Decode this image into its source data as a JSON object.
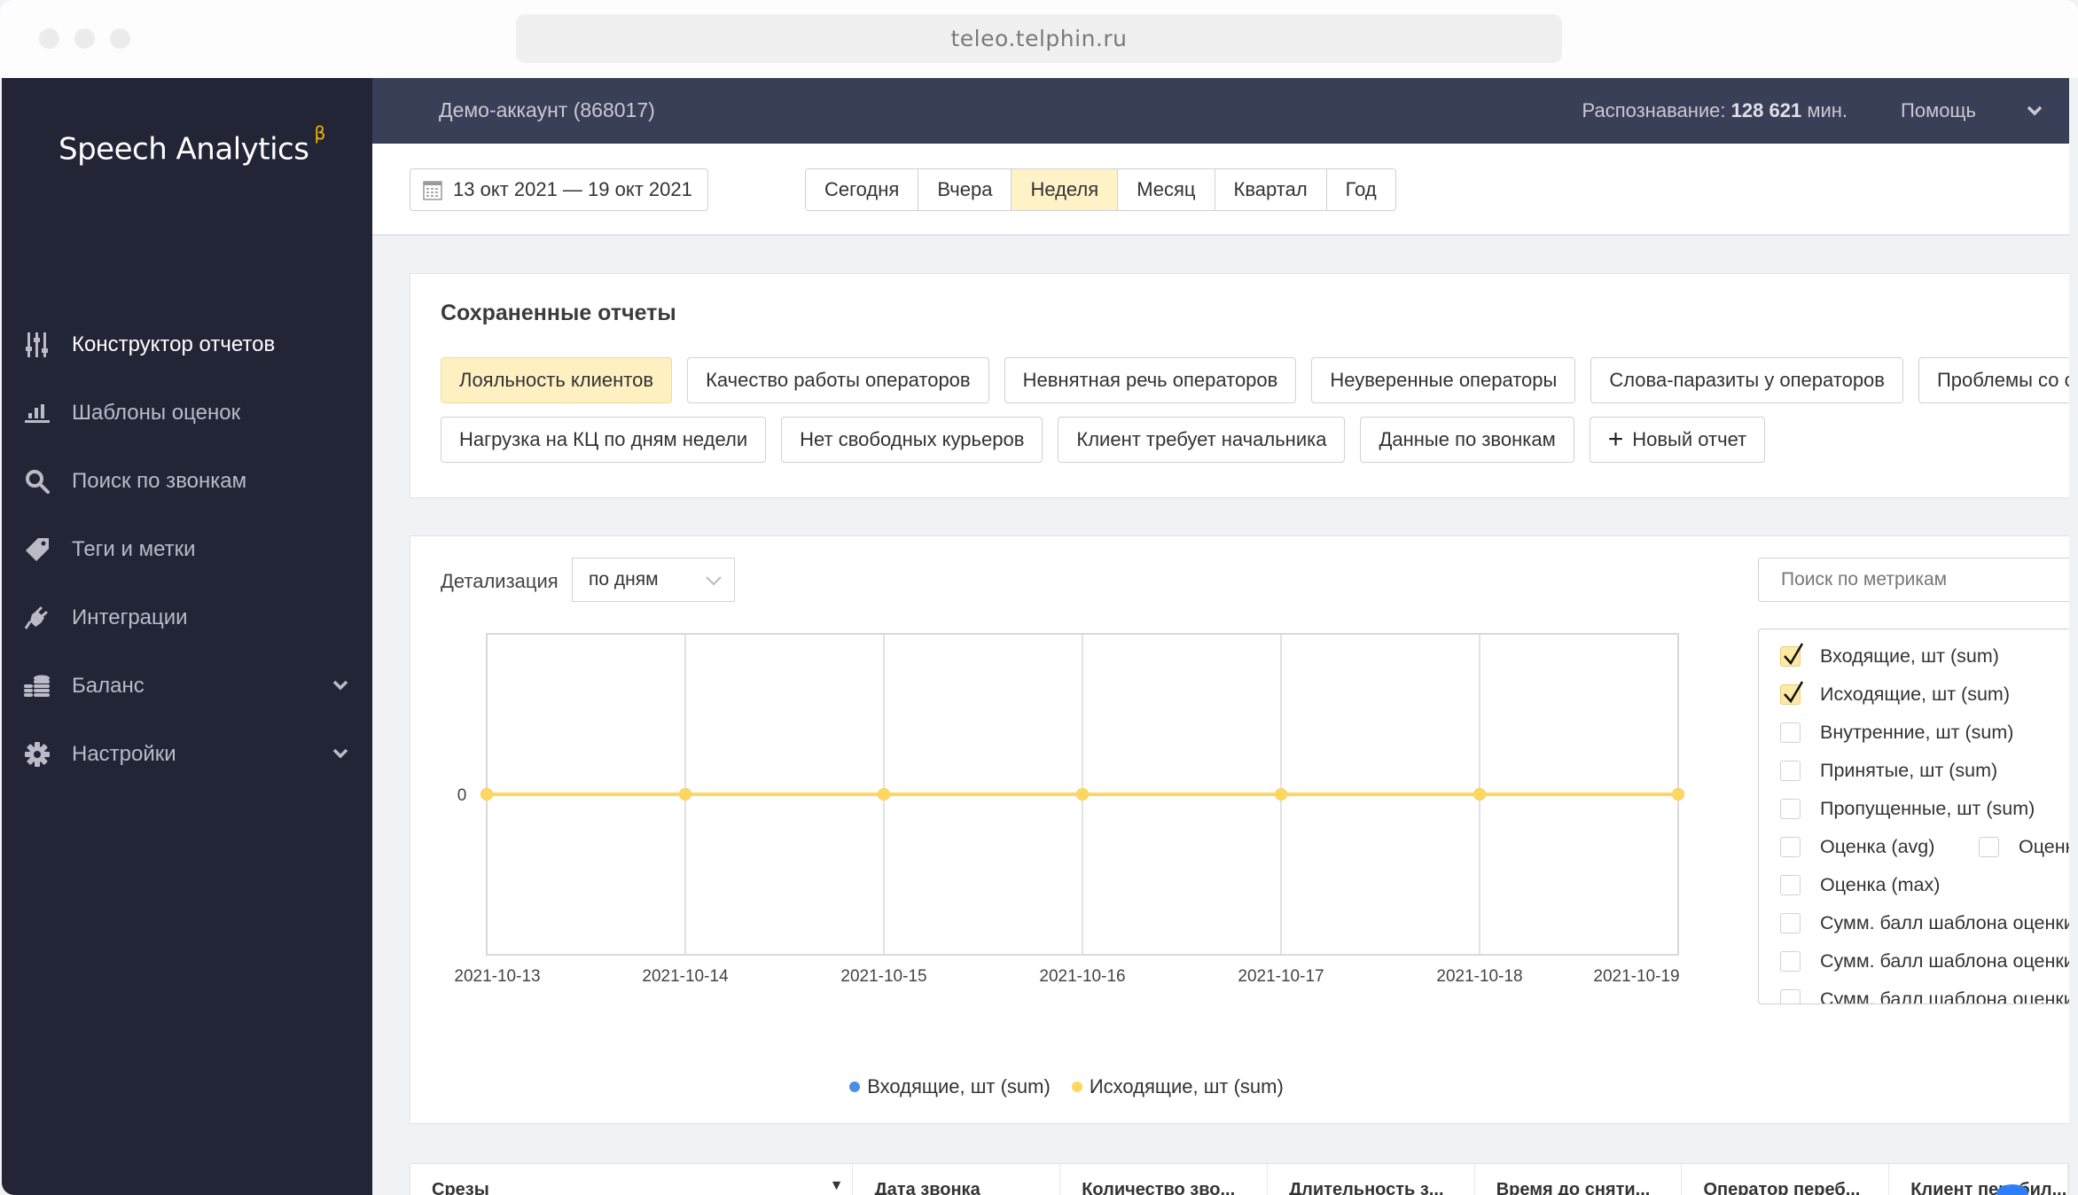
{
  "browser": {
    "url": "teleo.telphin.ru"
  },
  "sidebar": {
    "logo": "Speech Analytics",
    "logo_badge": "β",
    "items": [
      {
        "label": "Конструктор отчетов",
        "icon": "sliders-icon",
        "active": true
      },
      {
        "label": "Шаблоны оценок",
        "icon": "bar-chart-icon"
      },
      {
        "label": "Поиск по звонкам",
        "icon": "search-icon"
      },
      {
        "label": "Теги и метки",
        "icon": "tag-icon"
      },
      {
        "label": "Интеграции",
        "icon": "plug-icon"
      },
      {
        "label": "Баланс",
        "icon": "coins-icon",
        "expandable": true
      },
      {
        "label": "Настройки",
        "icon": "gear-icon",
        "expandable": true
      }
    ]
  },
  "header": {
    "account": "Демо-аккаунт (868017)",
    "recognition_label": "Распознавание:",
    "recognition_value": "128 621",
    "recognition_unit": "мин.",
    "help": "Помощь"
  },
  "toolbar": {
    "date_range": "13 окт 2021 — 19 окт 2021",
    "periods": [
      "Сегодня",
      "Вчера",
      "Неделя",
      "Месяц",
      "Квартал",
      "Год"
    ],
    "active_period": "Неделя"
  },
  "saved_reports": {
    "title": "Сохраненные отчеты",
    "row1": [
      "Лояльность клиентов",
      "Качество работы операторов",
      "Невнятная речь операторов",
      "Неуверенные операторы",
      "Слова-паразиты у операторов",
      "Проблемы со связью"
    ],
    "row2": [
      "Нагрузка на КЦ по дням недели",
      "Нет свободных курьеров",
      "Клиент требует начальника",
      "Данные по звонкам"
    ],
    "active": "Лояльность клиентов",
    "new_report": "Новый отчет"
  },
  "chart_panel": {
    "detail_label": "Детализация",
    "detail_value": "по дням",
    "metric_search_placeholder": "Поиск по метрикам",
    "metrics": [
      {
        "label": "Входящие, шт (sum)",
        "checked": true
      },
      {
        "label": "Исходящие, шт (sum)",
        "checked": true
      },
      {
        "label": "Внутренние, шт (sum)",
        "checked": false
      },
      {
        "label": "Принятые, шт (sum)",
        "checked": false
      },
      {
        "label": "Пропущенные, шт (sum)",
        "checked": false
      },
      {
        "label": "Оценка (avg)",
        "checked": false
      },
      {
        "label": "Оценка (min)",
        "checked": false
      },
      {
        "label": "Оценка (max)",
        "checked": false
      },
      {
        "label": "Сумм. балл шаблона оценки",
        "checked": false
      },
      {
        "label": "Сумм. балл шаблона оценки",
        "checked": false
      },
      {
        "label": "Сумм. балл шаблона оценки",
        "checked": false
      }
    ]
  },
  "chart_data": {
    "type": "line",
    "title": "",
    "xlabel": "",
    "ylabel": "",
    "x": [
      "2021-10-13",
      "2021-10-14",
      "2021-10-15",
      "2021-10-16",
      "2021-10-17",
      "2021-10-18",
      "2021-10-19"
    ],
    "y_ticks": [
      "0"
    ],
    "grid": true,
    "legend": "bottom",
    "series": [
      {
        "name": "Входящие, шт (sum)",
        "color": "#4a90e2",
        "values": [
          0,
          0,
          0,
          0,
          0,
          0,
          0
        ]
      },
      {
        "name": "Исходящие, шт (sum)",
        "color": "#ffd75e",
        "values": [
          0,
          0,
          0,
          0,
          0,
          0,
          0
        ]
      }
    ]
  },
  "table": {
    "columns": [
      "Срезы",
      "Дата звонка",
      "Количество зво...",
      "Длительность з...",
      "Время до сняти...",
      "Оператор переб...",
      "Клиент перебил..."
    ]
  },
  "colors": {
    "sidebar": "#212536",
    "header": "#3a3f58",
    "accent": "#fff2c7",
    "series_incoming": "#4a90e2",
    "series_outgoing": "#ffd75e"
  }
}
